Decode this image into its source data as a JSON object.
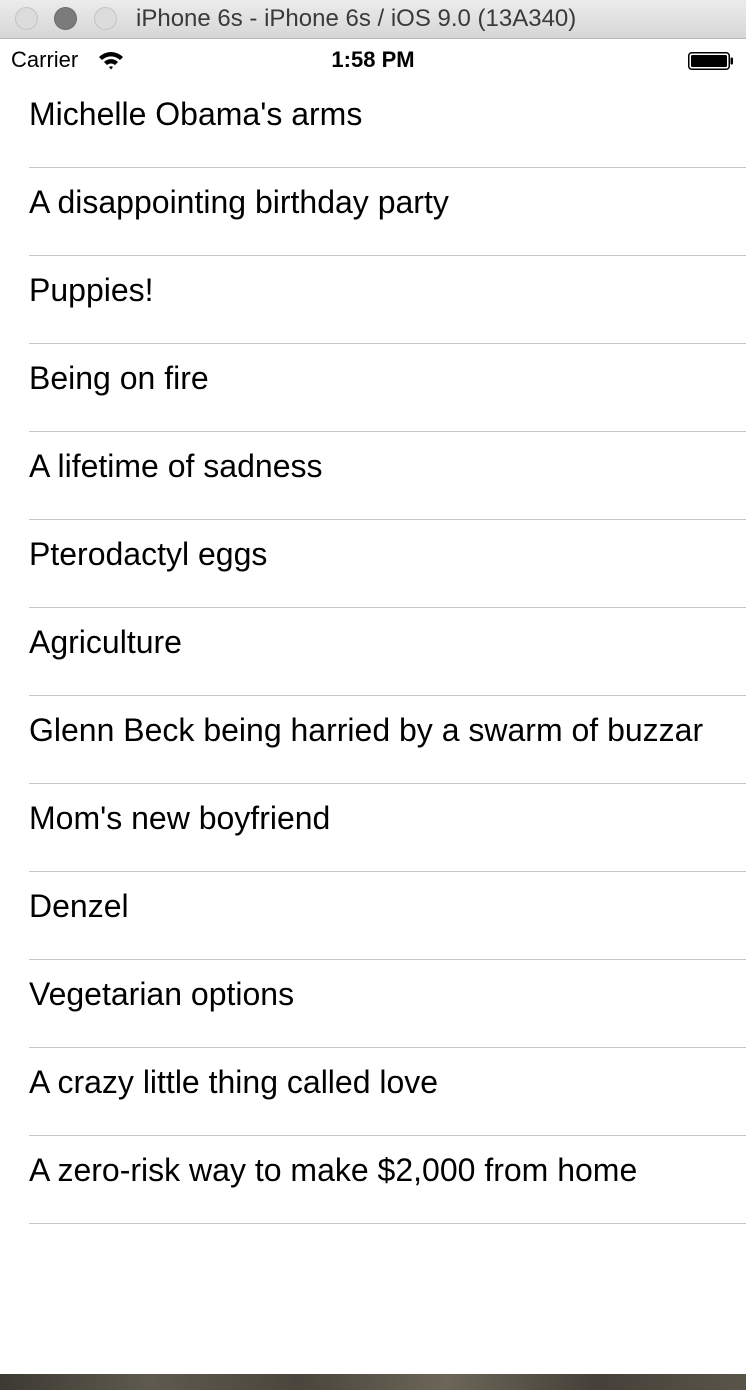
{
  "window": {
    "title": "iPhone 6s - iPhone 6s / iOS 9.0 (13A340)"
  },
  "status_bar": {
    "carrier": "Carrier",
    "time": "1:58 PM",
    "wifi_icon": "wifi-icon",
    "battery_icon": "battery-icon"
  },
  "list": {
    "items": [
      "Michelle Obama's arms",
      "A disappointing birthday party",
      "Puppies!",
      "Being on fire",
      "A lifetime of sadness",
      "Pterodactyl eggs",
      "Agriculture",
      "Glenn Beck being harried by a swarm of buzzar",
      "Mom's new boyfriend",
      "Denzel",
      "Vegetarian options",
      "A crazy little thing called love",
      "A zero-risk way to make $2,000 from home"
    ]
  }
}
